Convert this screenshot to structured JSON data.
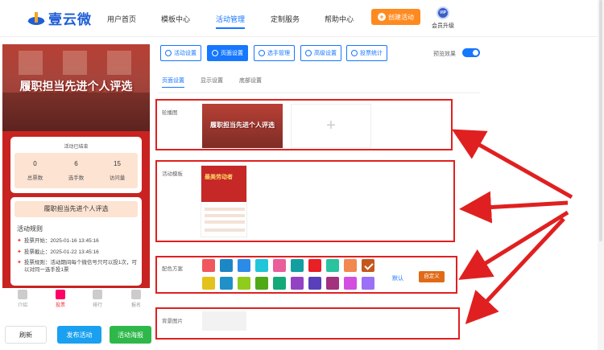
{
  "brand": {
    "name": "壹云微"
  },
  "nav": {
    "items": [
      "用户首页",
      "模板中心",
      "活动管理",
      "定制服务",
      "帮助中心"
    ],
    "create_label": "创建活动",
    "vip_badge": "VIP",
    "vip_label": "会员升级"
  },
  "preview": {
    "banner_title": "履职担当先进个人评选",
    "status": "活动已结束",
    "stats": [
      {
        "value": "0",
        "label": "总票数"
      },
      {
        "value": "6",
        "label": "选手数"
      },
      {
        "value": "15",
        "label": "访问量"
      }
    ],
    "rules_heading": "履职担当先进个人评选",
    "rules_title": "活动规则",
    "rules": [
      "投票开始：2025-01-16 13:45:16",
      "投票截止：2025-01-22 13:45:16",
      "投票规则：活动期间每个微信号只可以投1次，可以对同一选手投1票"
    ],
    "tabs": [
      "介绍",
      "投票",
      "排行",
      "报名"
    ]
  },
  "actions": {
    "refresh": "刷新",
    "publish": "发布活动",
    "poster": "活动海报"
  },
  "toolbar": {
    "buttons": [
      "活动设置",
      "页面设置",
      "选手管理",
      "高级设置",
      "投票统计"
    ],
    "preview_label": "预览效果"
  },
  "subtabs": [
    "页面设置",
    "显示设置",
    "底部设置"
  ],
  "settings": {
    "carousel_label": "轮播图",
    "carousel_thumb_text": "履职担当先进个人评选",
    "add_symbol": "+",
    "template_label": "活动模板",
    "template_thumb_text": "最美劳动者",
    "color_label": "配色方案",
    "default_label": "默认",
    "custom_label": "自定义",
    "bg_label": "背景图片"
  },
  "colors": {
    "accent": "#1677ff",
    "row1": [
      "#f0575d",
      "#1d87c6",
      "#2d8be8",
      "#1fc5d9",
      "#e95f9a",
      "#139fa2",
      "#e81f25",
      "#29c39e",
      "#f2874f",
      "#c5571e"
    ],
    "row2": [
      "#e4c21c",
      "#1f90c8",
      "#8fcc1b",
      "#4ea916",
      "#15a97a",
      "#9442c4",
      "#5a3fba",
      "#a2317e",
      "#d24fe0",
      "#9b6ff6"
    ]
  }
}
